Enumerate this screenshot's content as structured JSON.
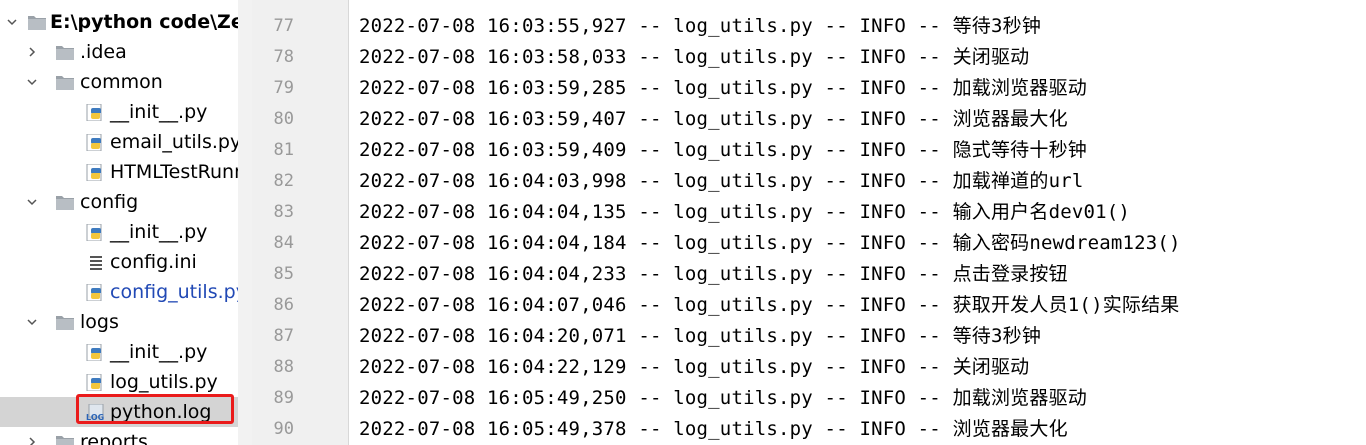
{
  "project_tree": {
    "items": [
      {
        "label": "E:\\python code\\ZenDa",
        "type": "root",
        "expanded": true,
        "bold": true
      },
      {
        "label": ".idea",
        "type": "folder",
        "expanded": false
      },
      {
        "label": "common",
        "type": "folder",
        "expanded": true
      },
      {
        "label": "__init__.py",
        "type": "python"
      },
      {
        "label": "email_utils.py",
        "type": "python"
      },
      {
        "label": "HTMLTestRunne",
        "type": "python"
      },
      {
        "label": "config",
        "type": "folder",
        "expanded": true
      },
      {
        "label": "__init__.py",
        "type": "python"
      },
      {
        "label": "config.ini",
        "type": "ini"
      },
      {
        "label": "config_utils.py",
        "type": "python",
        "modified": true
      },
      {
        "label": "logs",
        "type": "folder",
        "expanded": true
      },
      {
        "label": "__init__.py",
        "type": "python"
      },
      {
        "label": "log_utils.py",
        "type": "python"
      },
      {
        "label": "python.log",
        "type": "log",
        "selected": true
      },
      {
        "label": "reports",
        "type": "folder",
        "expanded": false
      }
    ]
  },
  "editor": {
    "lines": [
      {
        "num": "77",
        "text": "2022-07-08 16:03:55,927 -- log_utils.py -- INFO -- 等待3秒钟"
      },
      {
        "num": "78",
        "text": "2022-07-08 16:03:58,033 -- log_utils.py -- INFO -- 关闭驱动"
      },
      {
        "num": "79",
        "text": "2022-07-08 16:03:59,285 -- log_utils.py -- INFO -- 加载浏览器驱动"
      },
      {
        "num": "80",
        "text": "2022-07-08 16:03:59,407 -- log_utils.py -- INFO -- 浏览器最大化"
      },
      {
        "num": "81",
        "text": "2022-07-08 16:03:59,409 -- log_utils.py -- INFO -- 隐式等待十秒钟"
      },
      {
        "num": "82",
        "text": "2022-07-08 16:04:03,998 -- log_utils.py -- INFO -- 加载禅道的url"
      },
      {
        "num": "83",
        "text": "2022-07-08 16:04:04,135 -- log_utils.py -- INFO -- 输入用户名dev01()"
      },
      {
        "num": "84",
        "text": "2022-07-08 16:04:04,184 -- log_utils.py -- INFO -- 输入密码newdream123()"
      },
      {
        "num": "85",
        "text": "2022-07-08 16:04:04,233 -- log_utils.py -- INFO -- 点击登录按钮"
      },
      {
        "num": "86",
        "text": "2022-07-08 16:04:07,046 -- log_utils.py -- INFO -- 获取开发人员1()实际结果"
      },
      {
        "num": "87",
        "text": "2022-07-08 16:04:20,071 -- log_utils.py -- INFO -- 等待3秒钟"
      },
      {
        "num": "88",
        "text": "2022-07-08 16:04:22,129 -- log_utils.py -- INFO -- 关闭驱动"
      },
      {
        "num": "89",
        "text": "2022-07-08 16:05:49,250 -- log_utils.py -- INFO -- 加载浏览器驱动"
      },
      {
        "num": "90",
        "text": "2022-07-08 16:05:49,378 -- log_utils.py -- INFO -- 浏览器最大化"
      }
    ]
  },
  "colors": {
    "selection_outline": "#ea1b1b",
    "modified_file": "#2149b5",
    "gutter_bg": "#f0f0f0"
  }
}
